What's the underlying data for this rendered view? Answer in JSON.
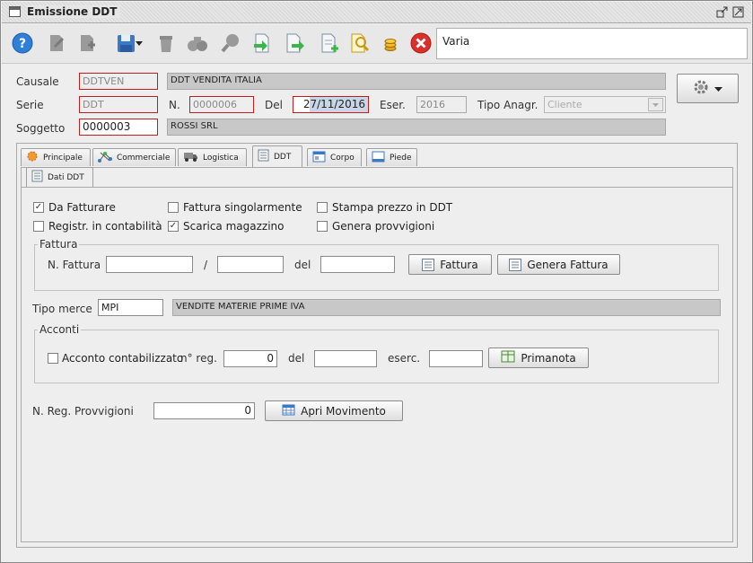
{
  "window": {
    "title": "Emissione DDT"
  },
  "toolbar": {
    "varia": "Varia"
  },
  "header": {
    "causale_label": "Causale",
    "causale_code": "DDTVEN",
    "causale_desc": "DDT VENDITA ITALIA",
    "serie_label": "Serie",
    "serie_value": "DDT",
    "n_label": "N.",
    "n_value": "0000006",
    "del_label": "Del",
    "del_value": "27/11/2016",
    "eser_label": "Eser.",
    "eser_value": "2016",
    "tipo_anagr_label": "Tipo Anagr.",
    "tipo_anagr_value": "Cliente",
    "soggetto_label": "Soggetto",
    "soggetto_code": "0000003",
    "soggetto_desc": "ROSSI SRL"
  },
  "tabs": [
    "Principale",
    "Commerciale",
    "Logistica",
    "DDT",
    "Corpo",
    "Piede"
  ],
  "subtab": "Dati DDT",
  "checks": {
    "da_fatturare": "Da Fatturare",
    "fattura_singolarmente": "Fattura singolarmente",
    "stampa_prezzo": "Stampa prezzo in DDT",
    "registr_contabilita": "Registr. in contabilità",
    "scarica_magazzino": "Scarica magazzino",
    "genera_provvigioni": "Genera provvigioni",
    "check_mark": "✓"
  },
  "fattura": {
    "group": "Fattura",
    "n_fattura_label": "N. Fattura",
    "slash": "/",
    "del_label": "del",
    "btn_fattura": "Fattura",
    "btn_genera": "Genera Fattura"
  },
  "tipo_merce": {
    "label": "Tipo merce",
    "code": "MPI",
    "desc": "VENDITE MATERIE PRIME IVA"
  },
  "acconti": {
    "group": "Acconti",
    "acconto_label": "Acconto contabilizzato",
    "nreg_label": "n° reg.",
    "nreg_value": "0",
    "del_label": "del",
    "eserc_label": "eserc.",
    "btn_primanota": "Primanota"
  },
  "provvigioni": {
    "label": "N. Reg. Provvigioni",
    "value": "0",
    "btn_apri": "Apri Movimento"
  },
  "colors": {
    "error_border": "#c01e1e",
    "accent_blue": "#2f7fd6",
    "close_red": "#d9302c"
  }
}
